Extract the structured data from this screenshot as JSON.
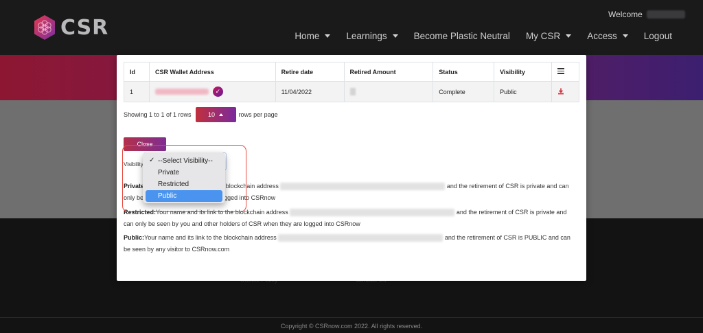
{
  "header": {
    "brand": "CSR",
    "welcome_label": "Welcome",
    "nav": [
      "Home",
      "Learnings",
      "Become Plastic Neutral",
      "My CSR",
      "Access",
      "Logout"
    ]
  },
  "footer": {
    "ghost_left": "Cookie Policy",
    "ghost_right": "Contact Us",
    "copyright": "Copyright © CSRnow.com 2022. All rights reserved."
  },
  "modal": {
    "table": {
      "headers": [
        "Id",
        "CSR Wallet Address",
        "Retire date",
        "Retired Amount",
        "Status",
        "Visibility"
      ],
      "rows": [
        {
          "id": "1",
          "retire_date": "11/04/2022",
          "status": "Complete",
          "visibility": "Public"
        }
      ]
    },
    "pagination": {
      "showing": "Showing 1 to 1 of 1 rows",
      "page_size": "10",
      "rows_per_page": "rows per page"
    },
    "close_label": "Close",
    "visibility_label": "Visibility",
    "descriptions": {
      "private_title": "Private:",
      "private_text_a": "Your name and its link to the blockchain address",
      "private_text_b": "and the retirement of CSR is private and can only be seen by you when you are logged into CSRnow",
      "restricted_title": "Restricted:",
      "restricted_text_a": "Your name and its link to the blockchain address",
      "restricted_text_b": "and the retirement of CSR is private and can only be seen by you and other holders of CSR when they are logged into CSRnow",
      "public_title": "Public:",
      "public_text_a": "Your name and its link to the blockchain address",
      "public_text_b": "and the retirement of CSR is PUBLIC and can be seen by any visitor to CSRnow.com"
    }
  },
  "dropdown": {
    "options": [
      "--Select Visibility--",
      "Private",
      "Restricted",
      "Public"
    ],
    "checked_index": 0,
    "highlighted_index": 3
  },
  "colors": {
    "accent_red": "#c1303d",
    "accent_purple": "#7a2a9e",
    "highlight_blue": "#4a94f0",
    "annotation_red": "#e8493e"
  }
}
